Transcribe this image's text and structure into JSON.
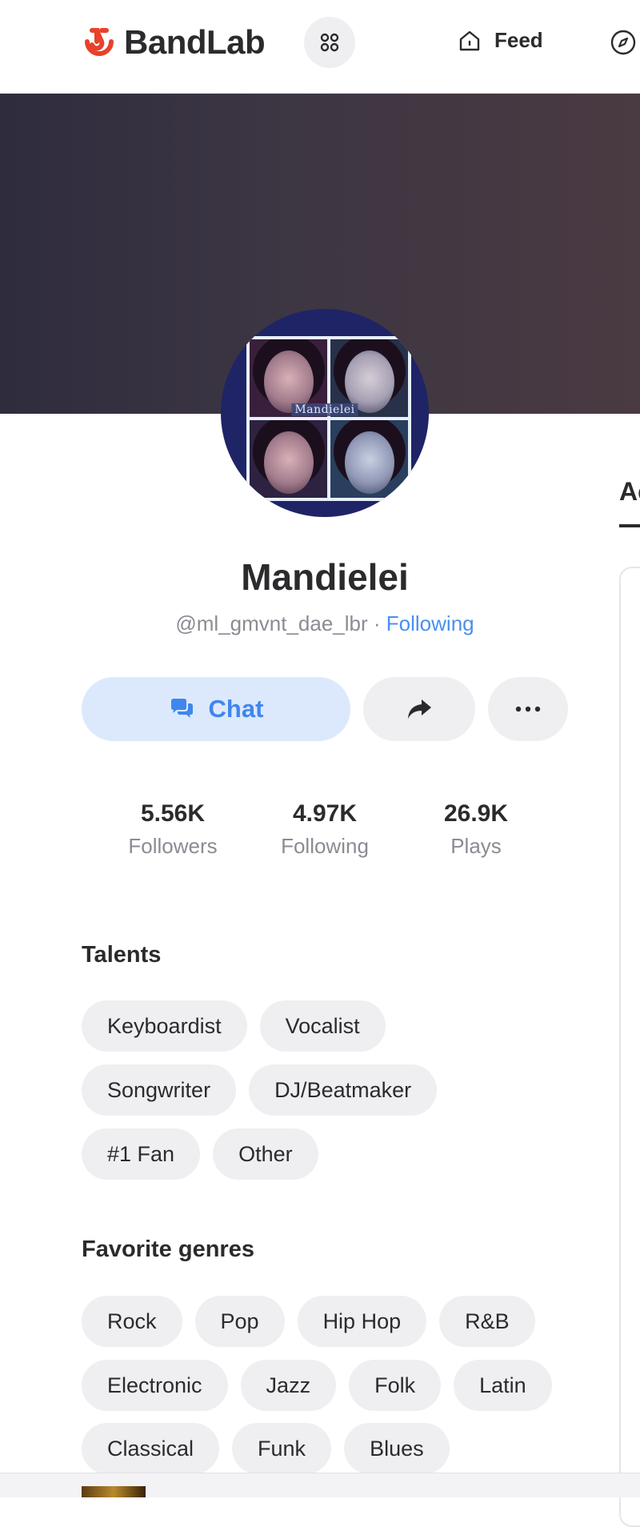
{
  "app": {
    "name": "BandLab"
  },
  "nav": {
    "feed_label": "Feed"
  },
  "profile": {
    "display_name": "Mandielei",
    "handle": "@ml_gmvnt_dae_lbr",
    "separator": " · ",
    "follow_status": "Following",
    "avatar_caption": "Mandielei"
  },
  "actions": {
    "chat_label": "Chat"
  },
  "stats": [
    {
      "value": "5.56K",
      "label": "Followers"
    },
    {
      "value": "4.97K",
      "label": "Following"
    },
    {
      "value": "26.9K",
      "label": "Plays"
    }
  ],
  "talents": {
    "title": "Talents",
    "rows": [
      [
        "Keyboardist",
        "Vocalist"
      ],
      [
        "Songwriter",
        "DJ/Beatmaker"
      ],
      [
        "#1 Fan",
        "Other"
      ]
    ]
  },
  "genres": {
    "title": "Favorite genres",
    "rows": [
      [
        "Rock",
        "Pop",
        "Hip Hop",
        "R&B"
      ],
      [
        "Electronic",
        "Jazz",
        "Folk",
        "Latin"
      ],
      [
        "Classical",
        "Funk",
        "Blues"
      ]
    ]
  },
  "side_panel": {
    "tab_label": "Ac"
  },
  "colors": {
    "brand_red": "#e8412c",
    "accent_blue": "#4a8ff0",
    "chat_bg": "#dce9fc",
    "chip_bg": "#efeff2",
    "text_dark": "#2b2b2e",
    "text_muted": "#8b8b93"
  },
  "icons": {
    "logo": "bandlab-logo-icon",
    "apps": "apps-grid-icon",
    "feed": "home-icon",
    "explore": "compass-icon",
    "chat": "chat-bubbles-icon",
    "share": "share-arrow-icon",
    "more": "more-dots-icon"
  }
}
